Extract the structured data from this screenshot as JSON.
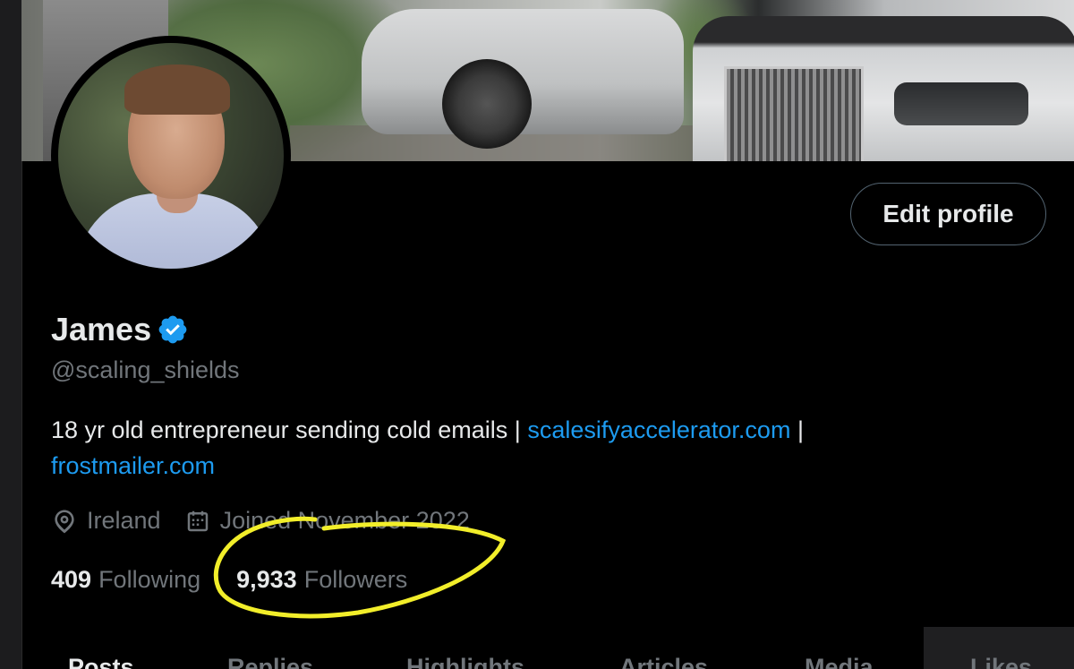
{
  "profile": {
    "name": "James",
    "handle": "@scaling_shields",
    "bio_text": "18 yr old entrepreneur sending cold emails |",
    "bio_link1": "scalesifyaccelerator.com",
    "bio_sep": "|",
    "bio_link2": "frostmailer.com",
    "location": "Ireland",
    "joined": "Joined November 2022",
    "following_count": "409",
    "following_label": "Following",
    "followers_count": "9,933",
    "followers_label": "Followers",
    "edit_label": "Edit profile"
  },
  "tabs": [
    "Posts",
    "Replies",
    "Highlights",
    "Articles",
    "Media",
    "Likes"
  ],
  "icons": {
    "verified": "verified-badge-icon",
    "location": "location-pin-icon",
    "calendar": "calendar-icon"
  },
  "colors": {
    "link": "#1d9bf0",
    "muted": "#71767b",
    "annotation": "#f2ee2a",
    "background": "#000000"
  }
}
